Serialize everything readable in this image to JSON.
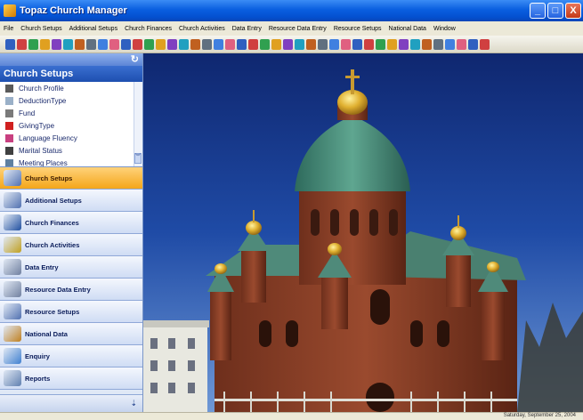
{
  "window": {
    "title": "Topaz Church Manager",
    "buttons": {
      "minimize": "_",
      "maximize": "□",
      "close": "X"
    }
  },
  "menu": [
    "File",
    "Church Setups",
    "Additional Setups",
    "Church Finances",
    "Church Activities",
    "Data Entry",
    "Resource Data Entry",
    "Resource Setups",
    "National Data",
    "Window"
  ],
  "sidebar": {
    "refresh_icon": "↻",
    "title": "Church Setups",
    "setup_items": [
      {
        "label": "Church Profile",
        "icon": "profile-icon",
        "color": "#5a5a5a"
      },
      {
        "label": "DeductionType",
        "icon": "deduction-icon",
        "color": "#9ab0c8"
      },
      {
        "label": "Fund",
        "icon": "fund-icon",
        "color": "#7a7a7a"
      },
      {
        "label": "GivingType",
        "icon": "giving-icon",
        "color": "#d02020"
      },
      {
        "label": "Language Fluency",
        "icon": "language-icon",
        "color": "#c84080"
      },
      {
        "label": "Marital Status",
        "icon": "marital-icon",
        "color": "#404040"
      },
      {
        "label": "Meeting Places",
        "icon": "meeting-icon",
        "color": "#6080a0"
      }
    ],
    "scroll_chevron": "︾",
    "nav": [
      {
        "label": "Church Setups",
        "icon": "church-setups-icon",
        "active": true
      },
      {
        "label": "Additional Setups",
        "icon": "additional-setups-icon",
        "active": false
      },
      {
        "label": "Church Finances",
        "icon": "church-finances-icon",
        "active": false
      },
      {
        "label": "Church Activities",
        "icon": "church-activities-icon",
        "active": false
      },
      {
        "label": "Data Entry",
        "icon": "data-entry-icon",
        "active": false
      },
      {
        "label": "Resource Data Entry",
        "icon": "resource-data-entry-icon",
        "active": false
      },
      {
        "label": "Resource Setups",
        "icon": "resource-setups-icon",
        "active": false
      },
      {
        "label": "National Data",
        "icon": "national-data-icon",
        "active": false
      },
      {
        "label": "Enquiry",
        "icon": "enquiry-icon",
        "active": false
      },
      {
        "label": "Reports",
        "icon": "reports-icon",
        "active": false
      }
    ],
    "nav_chevron": "⇣"
  },
  "main": {
    "image": "cathedral-photo"
  },
  "status": {
    "date": "Saturday, September 25, 2004"
  },
  "colors": {
    "titlebar": "#0a5fe0",
    "active_nav": "#f4a61a",
    "sidebar_header": "#1e4fb0"
  }
}
